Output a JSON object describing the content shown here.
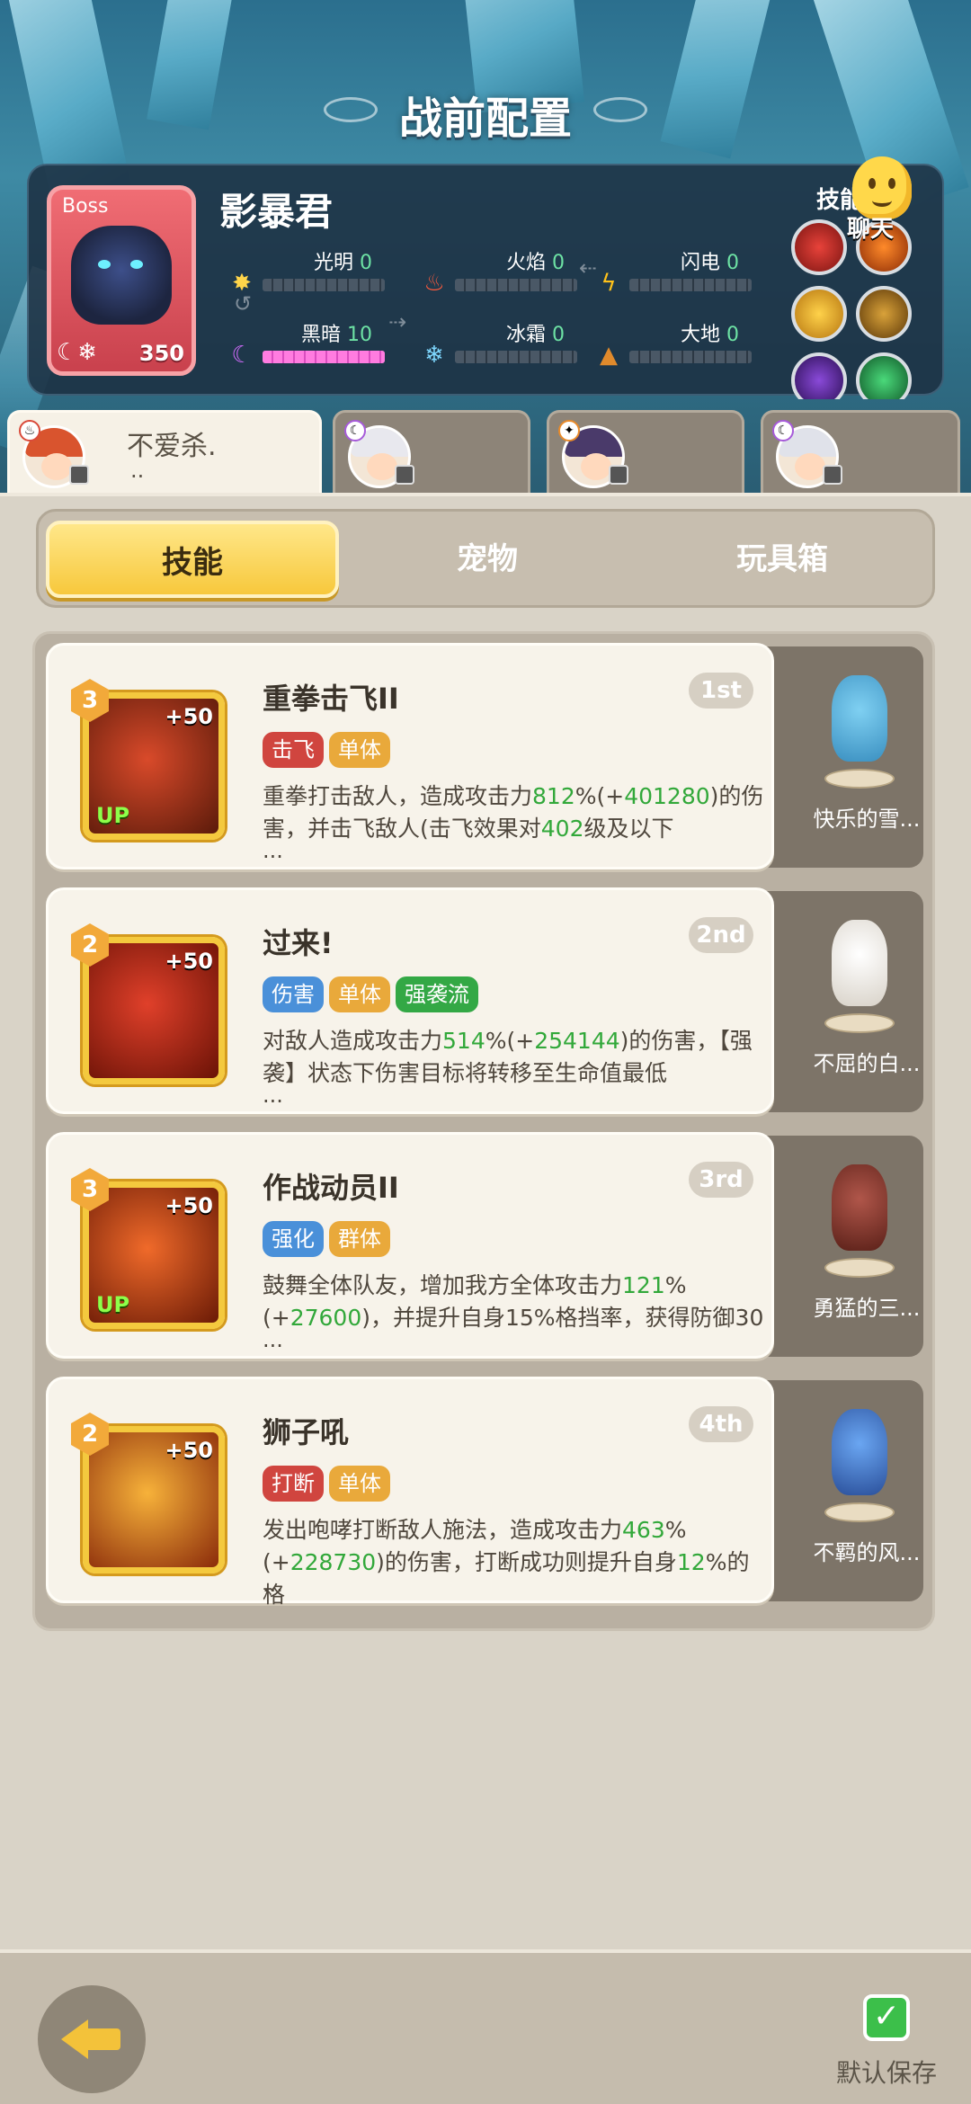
{
  "header": {
    "title": "战前配置"
  },
  "boss": {
    "tag": "Boss",
    "name": "影暴君",
    "level": "350",
    "stats": [
      {
        "label": "光明",
        "value": "0",
        "icon": "sun-icon"
      },
      {
        "label": "火焰",
        "value": "0",
        "icon": "fire-icon"
      },
      {
        "label": "闪电",
        "value": "0",
        "icon": "lightning-icon"
      },
      {
        "label": "黑暗",
        "value": "10",
        "icon": "moon-icon"
      },
      {
        "label": "冰霜",
        "value": "0",
        "icon": "snowflake-icon"
      },
      {
        "label": "大地",
        "value": "0",
        "icon": "earth-icon"
      }
    ],
    "skills_label": "技能",
    "chat_label": "聊天"
  },
  "heroes": [
    {
      "name": "不爱杀.",
      "sub": "..",
      "active": true
    },
    {
      "name": "",
      "sub": "",
      "active": false
    },
    {
      "name": "",
      "sub": "",
      "active": false
    },
    {
      "name": "",
      "sub": "",
      "active": false
    }
  ],
  "tabs": [
    "技能",
    "宠物",
    "玩具箱"
  ],
  "skills": [
    {
      "level": "3",
      "plus": "+50",
      "up": "UP",
      "title": "重拳击飞II",
      "rank": "1st",
      "tags": [
        {
          "text": "击飞",
          "color": "#d0453f"
        },
        {
          "text": "单体",
          "color": "#e9a93b"
        }
      ],
      "desc_a": "重拳打击敌人，造成攻击力",
      "desc_b": "812",
      "desc_c": "%(+",
      "desc_d": "401280",
      "desc_e": ")的伤害，并击飞敌人(击飞效果对",
      "desc_f": "402",
      "desc_g": "级及以下",
      "more": "...",
      "pet": "快乐的雪..."
    },
    {
      "level": "2",
      "plus": "+50",
      "up": "",
      "title": "过来!",
      "rank": "2nd",
      "tags": [
        {
          "text": "伤害",
          "color": "#4a90d9"
        },
        {
          "text": "单体",
          "color": "#e9a93b"
        },
        {
          "text": "强袭流",
          "color": "#33a845"
        }
      ],
      "desc_a": "对敌人造成攻击力",
      "desc_b": "514",
      "desc_c": "%(+",
      "desc_d": "254144",
      "desc_e": ")的伤害，【强袭】状态下伤害目标将转移至生命值最低",
      "desc_f": "",
      "desc_g": "",
      "more": "...",
      "pet": "不屈的白..."
    },
    {
      "level": "3",
      "plus": "+50",
      "up": "UP",
      "title": "作战动员II",
      "rank": "3rd",
      "tags": [
        {
          "text": "强化",
          "color": "#4a90d9"
        },
        {
          "text": "群体",
          "color": "#e9a93b"
        }
      ],
      "desc_a": "鼓舞全体队友，增加我方全体攻击力",
      "desc_b": "121",
      "desc_c": "%(+",
      "desc_d": "27600",
      "desc_e": ")，并提升自身15%格挡率，获得防御30",
      "desc_f": "",
      "desc_g": "",
      "more": "...",
      "pet": "勇猛的三..."
    },
    {
      "level": "2",
      "plus": "+50",
      "up": "",
      "title": "狮子吼",
      "rank": "4th",
      "tags": [
        {
          "text": "打断",
          "color": "#d0453f"
        },
        {
          "text": "单体",
          "color": "#e9a93b"
        }
      ],
      "desc_a": "发出咆哮打断敌人施法，造成攻击力",
      "desc_b": "463",
      "desc_c": "%(+",
      "desc_d": "228730",
      "desc_e": ")的伤害，打断成功则提升自身",
      "desc_f": "12",
      "desc_g": "%的格",
      "more": "...",
      "pet": "不羁的风..."
    }
  ],
  "footer": {
    "save_label": "默认保存"
  }
}
